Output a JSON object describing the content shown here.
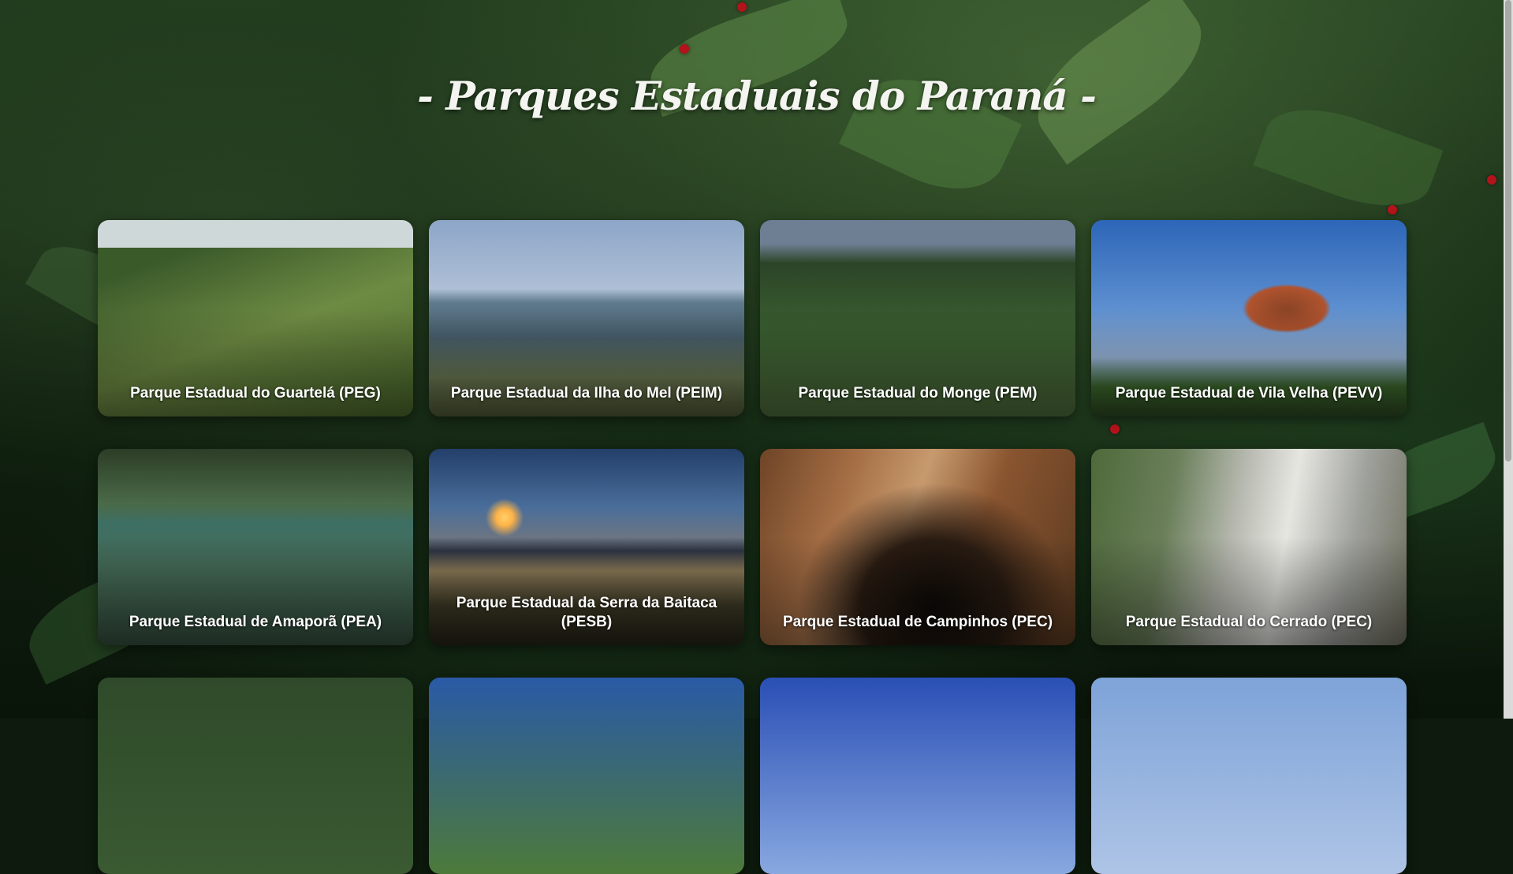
{
  "page": {
    "title": "- Parques Estaduais do Paraná -"
  },
  "parks": [
    {
      "name": "Parque Estadual do Guartelá (PEG)"
    },
    {
      "name": "Parque Estadual da Ilha do Mel (PEIM)"
    },
    {
      "name": "Parque Estadual do Monge (PEM)"
    },
    {
      "name": "Parque Estadual de Vila Velha (PEVV)"
    },
    {
      "name": "Parque Estadual de Amaporã (PEA)"
    },
    {
      "name": "Parque Estadual da Serra da Baitaca (PESB)"
    },
    {
      "name": "Parque Estadual de Campinhos (PEC)"
    },
    {
      "name": "Parque Estadual do Cerrado (PEC)"
    },
    {
      "name": ""
    },
    {
      "name": ""
    },
    {
      "name": ""
    },
    {
      "name": ""
    }
  ],
  "colors": {
    "berry": "#b3131a",
    "title_text": "#f4f4f0",
    "caption_text": "#ffffff"
  }
}
